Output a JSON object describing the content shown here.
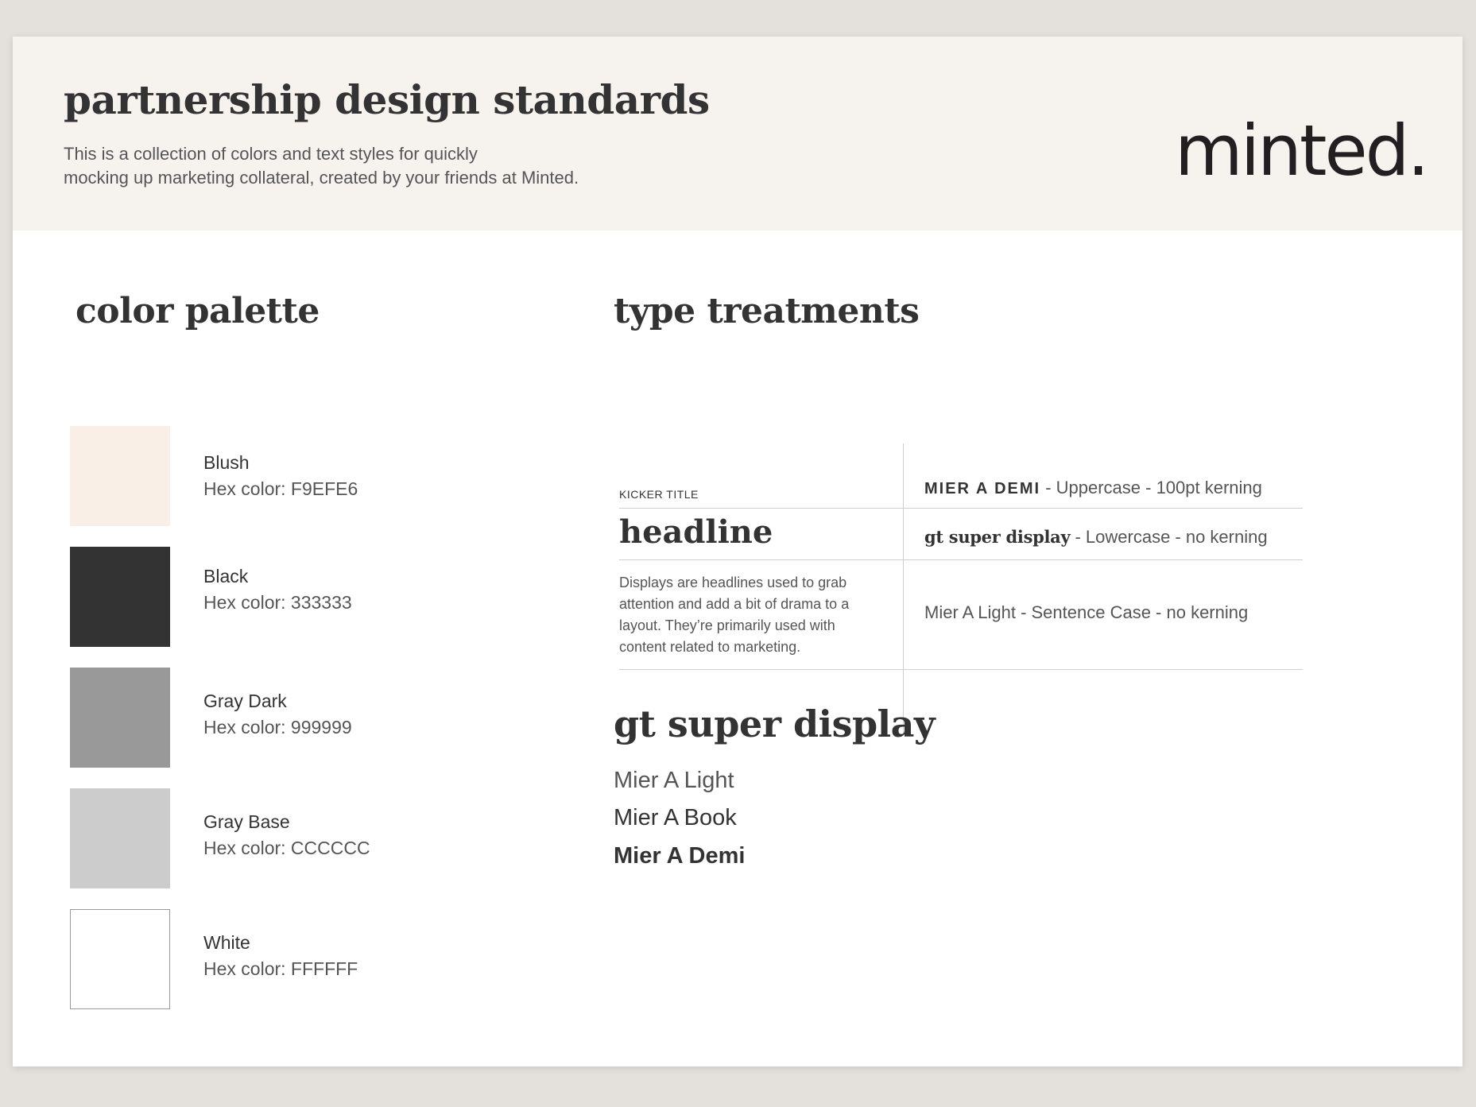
{
  "header": {
    "title": "partnership design standards",
    "intro_line1": "This is a collection of colors and text styles for quickly",
    "intro_line2": "mocking up marketing collateral, created by your friends at Minted.",
    "logo_text": "minted."
  },
  "color_palette": {
    "title": "color palette",
    "swatches": [
      {
        "name": "Blush",
        "hex_label": "Hex color: F9EFE6",
        "color": "#F9EFE6"
      },
      {
        "name": "Black",
        "hex_label": "Hex color: 333333",
        "color": "#333333"
      },
      {
        "name": "Gray Dark",
        "hex_label": "Hex color: 999999",
        "color": "#999999"
      },
      {
        "name": "Gray Base",
        "hex_label": "Hex color: CCCCCC",
        "color": "#CCCCCC"
      },
      {
        "name": "White",
        "hex_label": "Hex color: FFFFFF",
        "color": "#FFFFFF"
      }
    ]
  },
  "type_treatments": {
    "title": "type treatments",
    "kicker_title": "KICKER TITLE",
    "headline": "headline",
    "display_description": [
      "Displays are headlines used to grab",
      "attention and add a bit of drama to a",
      "layout. They’re primarily used with",
      "content related to marketing."
    ],
    "specs": [
      {
        "font": "MIER A DEMI",
        "rest": " - Uppercase - 100pt kerning"
      },
      {
        "font": "gt super display",
        "rest": " - Lowercase - no kerning"
      },
      {
        "font": "",
        "rest": "Mier A Light - Sentence Case - no kerning"
      }
    ]
  },
  "fonts": {
    "display_name": "gt super display",
    "light": "Mier A Light",
    "book": "Mier A Book",
    "demi": "Mier A Demi"
  }
}
